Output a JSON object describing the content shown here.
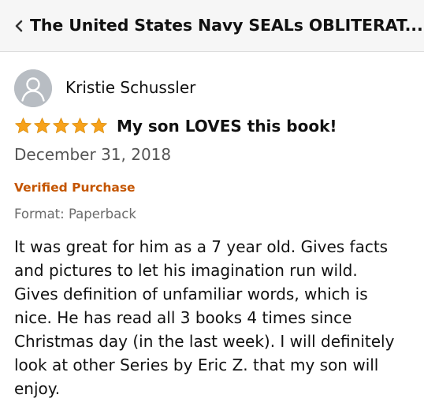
{
  "header": {
    "title": "The United States Navy SEALs OBLITERAT...",
    "back_icon": "chevron-left-icon"
  },
  "review": {
    "reviewer_name": "Kristie Schussler",
    "avatar_icon": "default-user-avatar-icon",
    "rating": 5,
    "rating_max": 5,
    "star_color": "#f7a21b",
    "title": "My son LOVES this book!",
    "date": "December 31, 2018",
    "verified_label": "Verified Purchase",
    "verified_color": "#c45500",
    "format_label": "Format: Paperback",
    "body_lines": [
      "It was great for him as a 7 year old. Gives facts",
      "and pictures to let his imagination run wild.",
      "Gives definition of unfamiliar words, which is",
      "nice. He has read all 3 books 4 times since",
      "Christmas day (in the last week). I will definitely",
      "look at other Series by Eric Z. that my son will",
      "enjoy."
    ]
  }
}
